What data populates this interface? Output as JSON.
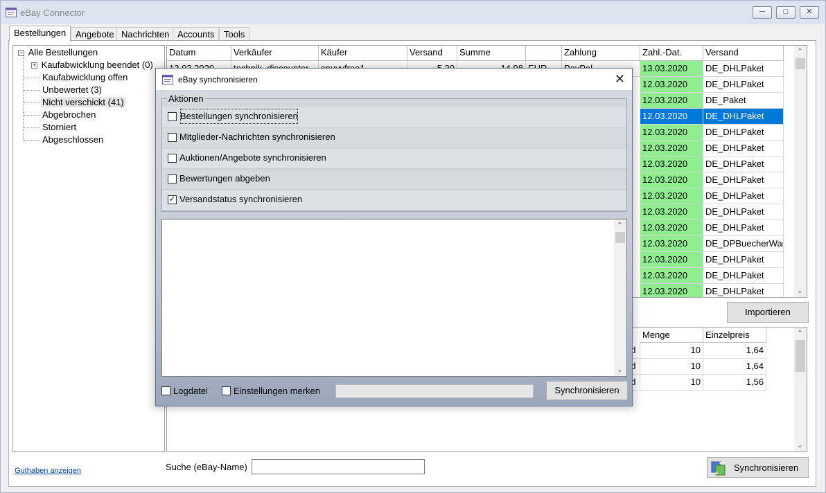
{
  "window": {
    "title": "eBay Connector"
  },
  "tabs": [
    "Bestellungen",
    "Angebote",
    "Nachrichten",
    "Accounts",
    "Tools"
  ],
  "tree": {
    "root": "Alle Bestellungen",
    "items": [
      "Kaufabwicklung beendet (0)",
      "Kaufabwicklung offen",
      "Unbewertet (3)",
      "Nicht verschickt (41)",
      "Abgebrochen",
      "Storniert",
      "Abgeschlossen"
    ]
  },
  "orders": {
    "columns": [
      "Datum",
      "Verkäufer",
      "Käufer",
      "Versand",
      "Summe",
      "",
      "Zahlung",
      "Zahl.-Dat.",
      "Versand"
    ],
    "first_row": {
      "datum": "13.03.2020",
      "verkaeufer": "technik_discounter",
      "kaeufer": "snuvyfree1",
      "versand": "5,30",
      "summe": "14,98",
      "waehrung": "EUR",
      "zahlung": "PayPal"
    },
    "rows": [
      {
        "date": "13.03.2020",
        "shipping": "DE_DHLPaket"
      },
      {
        "date": "12.03.2020",
        "shipping": "DE_DHLPaket"
      },
      {
        "date": "12.03.2020",
        "shipping": "DE_Paket"
      },
      {
        "date": "12.03.2020",
        "shipping": "DE_DHLPaket",
        "selected": true
      },
      {
        "date": "12.03.2020",
        "shipping": "DE_DHLPaket"
      },
      {
        "date": "12.03.2020",
        "shipping": "DE_DHLPaket"
      },
      {
        "date": "12.03.2020",
        "shipping": "DE_DHLPaket"
      },
      {
        "date": "12.03.2020",
        "shipping": "DE_DHLPaket"
      },
      {
        "date": "12.03.2020",
        "shipping": "DE_DHLPaket"
      },
      {
        "date": "12.03.2020",
        "shipping": "DE_DHLPaket"
      },
      {
        "date": "12.03.2020",
        "shipping": "DE_DHLPaket"
      },
      {
        "date": "12.03.2020",
        "shipping": "DE_DPBuecherWar"
      },
      {
        "date": "12.03.2020",
        "shipping": "DE_DHLPaket"
      },
      {
        "date": "12.03.2020",
        "shipping": "DE_DHLPaket"
      },
      {
        "date": "12.03.2020",
        "shipping": "DE_DHLPaket"
      }
    ]
  },
  "import_button": "Importieren",
  "details": {
    "columns": [
      "Menge",
      "Einzelpreis"
    ],
    "rows": [
      {
        "prefix": "nd",
        "menge": "10",
        "preis": "1,64"
      },
      {
        "prefix": "nd",
        "menge": "10",
        "preis": "1,64"
      },
      {
        "prefix": "nd",
        "menge": "10",
        "preis": "1,56"
      }
    ]
  },
  "footer": {
    "credit_link": "Guthaben anzeigen",
    "search_label": "Suche (eBay-Name)",
    "search_value": "",
    "sync_button": "Synchronisieren"
  },
  "dialog": {
    "title": "eBay synchronisieren",
    "group_label": "Aktionen",
    "actions": [
      {
        "label": "Bestellungen synchronisieren",
        "checked": false
      },
      {
        "label": "Mitglieder-Nachrichten synchronisieren",
        "checked": false
      },
      {
        "label": "Auktionen/Angebote synchronisieren",
        "checked": false
      },
      {
        "label": "Bewertungen abgeben",
        "checked": false
      },
      {
        "label": "Versandstatus synchronisieren",
        "checked": true
      }
    ],
    "logdatei_label": "Logdatei",
    "remember_label": "Einstellungen merken",
    "sync_button": "Synchronisieren",
    "progress": 0
  },
  "colors": {
    "green": "#90ee90",
    "selection": "#0078d7",
    "dialog_frame": "#8999b3"
  }
}
